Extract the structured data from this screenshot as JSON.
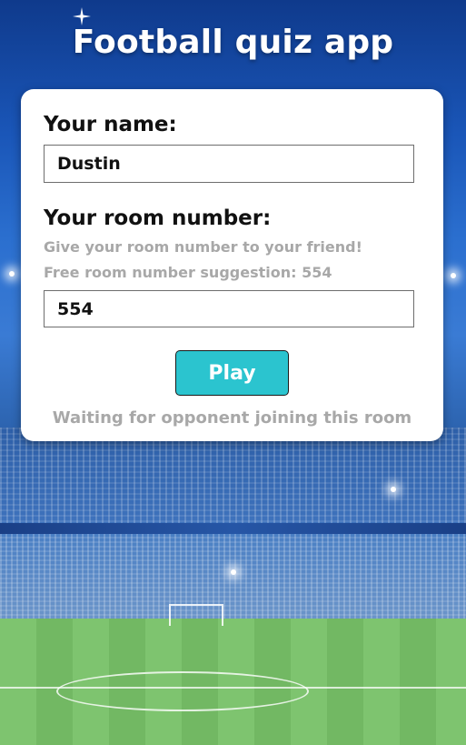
{
  "app": {
    "title": "Football quiz app"
  },
  "form": {
    "name_label": "Your name:",
    "name_value": "Dustin",
    "room_label": "Your room number:",
    "room_hint": "Give your room number to your friend!",
    "room_suggestion": "Free room number suggestion: 554",
    "room_value": "554",
    "play_label": "Play",
    "status_text": "Waiting for opponent joining this room"
  },
  "colors": {
    "accent": "#2bc4cf",
    "hint_text": "#a8a8a8",
    "card_bg": "#ffffff"
  }
}
